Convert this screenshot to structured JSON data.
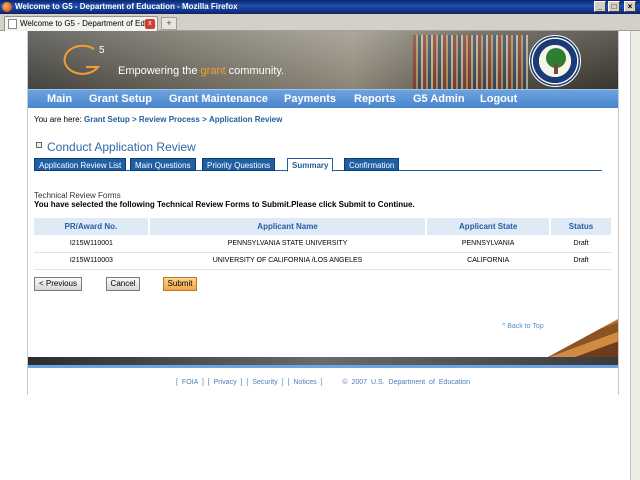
{
  "window": {
    "title": "Welcome to G5 - Department of Education - Mozilla Firefox",
    "tab_label": "Welcome to G5 - Department of Edu...",
    "new_tab_symbol": "+",
    "minimize": "_",
    "maximize": "□",
    "close": "×",
    "tab_close": "x"
  },
  "banner": {
    "logo_text": "G5",
    "tagline_prefix": "Empowering the ",
    "tagline_highlight": "grant",
    "tagline_suffix": " community.",
    "seal": "department-of-education-seal-icon"
  },
  "nav": {
    "items": [
      "Main",
      "Grant Setup",
      "Grant Maintenance",
      "Payments",
      "Reports",
      "G5 Admin",
      "Logout"
    ]
  },
  "breadcrumb": {
    "prefix": "You are here:",
    "items": [
      "Grant Setup",
      "Review Process",
      "Application Review"
    ],
    "separator": ">"
  },
  "page": {
    "title": "Conduct Application Review",
    "tabs": [
      "Application Review List",
      "Main Questions",
      "Priority Questions",
      "Summary",
      "Confirmation"
    ],
    "active_tab": "Summary",
    "section_label": "Technical Review Forms",
    "instruction": "You have selected the following Technical Review Forms to Submit.Please click Submit to Continue."
  },
  "table": {
    "headers": [
      "PR/Award No.",
      "Applicant Name",
      "Applicant State",
      "Status"
    ],
    "rows": [
      [
        "I215W110001",
        "PENNSYLVANIA STATE UNIVERSITY",
        "PENNSYLVANIA",
        "Draft"
      ],
      [
        "I215W110003",
        "UNIVERSITY OF CALIFORNIA /LOS ANGELES",
        "CALIFORNIA",
        "Draft"
      ]
    ]
  },
  "buttons": {
    "previous": "< Previous",
    "cancel": "Cancel",
    "submit": "Submit"
  },
  "back_to_top": "^ Back to Top",
  "footer": {
    "links": [
      "FOIA",
      "Privacy",
      "Security",
      "Notices"
    ],
    "copyright": "© 2007 U.S. Department of Education"
  },
  "colors": {
    "nav_blue": "#4a85cc",
    "link_blue": "#215f9e",
    "tab_blue": "#1f5fa3",
    "submit_orange": "#f2a54a"
  }
}
